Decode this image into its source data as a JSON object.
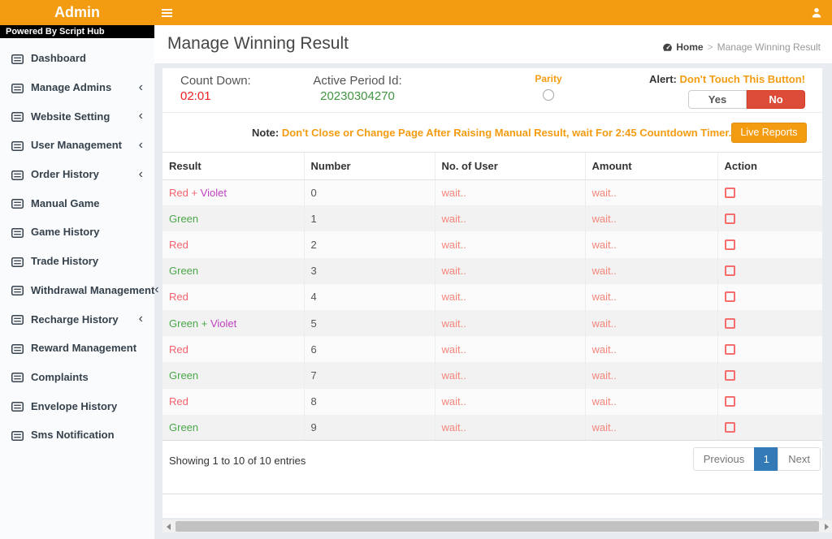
{
  "header": {
    "brand": "Admin"
  },
  "sidebar": {
    "powered_by": "Powered By Script Hub",
    "items": [
      {
        "label": "Dashboard",
        "has_submenu": false
      },
      {
        "label": "Manage Admins",
        "has_submenu": true
      },
      {
        "label": "Website Setting",
        "has_submenu": true
      },
      {
        "label": "User Management",
        "has_submenu": true
      },
      {
        "label": "Order History",
        "has_submenu": true
      },
      {
        "label": "Manual Game",
        "has_submenu": false
      },
      {
        "label": "Game History",
        "has_submenu": false
      },
      {
        "label": "Trade History",
        "has_submenu": false
      },
      {
        "label": "Withdrawal Management",
        "has_submenu": true
      },
      {
        "label": "Recharge History",
        "has_submenu": true
      },
      {
        "label": "Reward Management",
        "has_submenu": false
      },
      {
        "label": "Complaints",
        "has_submenu": false
      },
      {
        "label": "Envelope History",
        "has_submenu": false
      },
      {
        "label": "Sms Notification",
        "has_submenu": false
      }
    ]
  },
  "page": {
    "title": "Manage Winning Result",
    "breadcrumb": {
      "home": "Home",
      "separator": ">",
      "current": "Manage Winning Result"
    }
  },
  "panel": {
    "countdown_label": "Count Down:",
    "countdown_value": "02:01",
    "period_label": "Active Period Id:",
    "period_value": "20230304270",
    "parity_label": "Parity",
    "alert_prefix": "Alert:",
    "alert_text": "Don't Touch This Button!",
    "yes_label": "Yes",
    "no_label": "No"
  },
  "note": {
    "prefix": "Note:",
    "text": "Don't Close or Change Page After Raising Manual Result, wait For 2:45 Countdown Timer.",
    "live_reports_label": "Live Reports"
  },
  "table": {
    "columns": [
      "Result",
      "Number",
      "No. of User",
      "Amount",
      "Action"
    ],
    "rows": [
      {
        "result": [
          {
            "text": "Red + ",
            "color": "#f4626c"
          },
          {
            "text": "Violet",
            "color": "#c040c0"
          }
        ],
        "number": "0",
        "no_of_user": "wait..",
        "amount": "wait.."
      },
      {
        "result": [
          {
            "text": "Green",
            "color": "#49a749"
          }
        ],
        "number": "1",
        "no_of_user": "wait..",
        "amount": "wait.."
      },
      {
        "result": [
          {
            "text": "Red",
            "color": "#f4626c"
          }
        ],
        "number": "2",
        "no_of_user": "wait..",
        "amount": "wait.."
      },
      {
        "result": [
          {
            "text": "Green",
            "color": "#49a749"
          }
        ],
        "number": "3",
        "no_of_user": "wait..",
        "amount": "wait.."
      },
      {
        "result": [
          {
            "text": "Red",
            "color": "#f4626c"
          }
        ],
        "number": "4",
        "no_of_user": "wait..",
        "amount": "wait.."
      },
      {
        "result": [
          {
            "text": "Green + ",
            "color": "#49a749"
          },
          {
            "text": "Violet",
            "color": "#c040c0"
          }
        ],
        "number": "5",
        "no_of_user": "wait..",
        "amount": "wait.."
      },
      {
        "result": [
          {
            "text": "Red",
            "color": "#f4626c"
          }
        ],
        "number": "6",
        "no_of_user": "wait..",
        "amount": "wait.."
      },
      {
        "result": [
          {
            "text": "Green",
            "color": "#49a749"
          }
        ],
        "number": "7",
        "no_of_user": "wait..",
        "amount": "wait.."
      },
      {
        "result": [
          {
            "text": "Red",
            "color": "#f4626c"
          }
        ],
        "number": "8",
        "no_of_user": "wait..",
        "amount": "wait.."
      },
      {
        "result": [
          {
            "text": "Green",
            "color": "#49a749"
          }
        ],
        "number": "9",
        "no_of_user": "wait..",
        "amount": "wait.."
      }
    ]
  },
  "footer": {
    "showing": "Showing 1 to 10 of 10 entries",
    "previous_label": "Previous",
    "page_label": "1",
    "next_label": "Next"
  },
  "colors": {
    "accent_orange": "#f39c12",
    "danger_red": "#dd4b39",
    "active_page_blue": "#337ab7",
    "countdown_red": "#ee2222",
    "period_green": "#419641",
    "wait_text": "#f6857b",
    "result_red": "#f4626c",
    "result_green": "#49a749",
    "result_violet": "#c040c0"
  }
}
